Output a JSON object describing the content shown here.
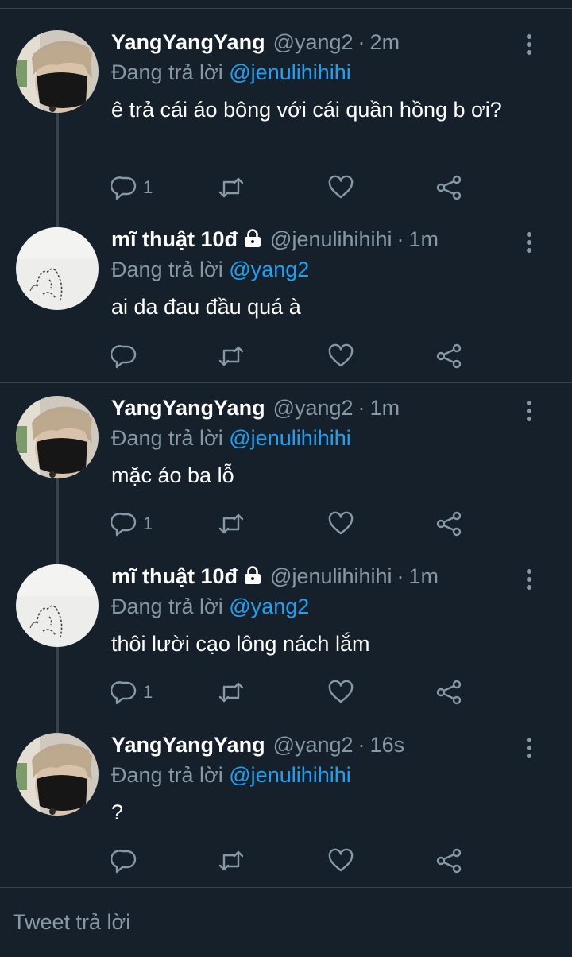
{
  "tweets": [
    {
      "name": "YangYangYang",
      "locked": false,
      "handle": "@yang2",
      "time": "2m",
      "replying_prefix": "Đang trả lời ",
      "replying_to": "@jenulihihihi",
      "text": "ê trả cái áo bông với cái quần hồng b ơi?",
      "reply_count": "1",
      "avatar": "masked-person"
    },
    {
      "name": "mĩ thuật 10đ",
      "locked": true,
      "handle": "@jenulihihihi",
      "time": "1m",
      "replying_prefix": "Đang trả lời ",
      "replying_to": "@yang2",
      "text": "ai da đau đầu quá à",
      "reply_count": "",
      "avatar": "sketch"
    },
    {
      "name": "YangYangYang",
      "locked": false,
      "handle": "@yang2",
      "time": "1m",
      "replying_prefix": "Đang trả lời ",
      "replying_to": "@jenulihihihi",
      "text": "mặc áo ba lỗ",
      "reply_count": "1",
      "avatar": "masked-person"
    },
    {
      "name": "mĩ thuật 10đ",
      "locked": true,
      "handle": "@jenulihihihi",
      "time": "1m",
      "replying_prefix": "Đang trả lời ",
      "replying_to": "@yang2",
      "text": "thôi lười cạo lông nách lắm",
      "reply_count": "1",
      "avatar": "sketch"
    },
    {
      "name": "YangYangYang",
      "locked": false,
      "handle": "@yang2",
      "time": "16s",
      "replying_prefix": "Đang trả lời ",
      "replying_to": "@jenulihihihi",
      "text": "?",
      "reply_count": "",
      "avatar": "masked-person"
    }
  ],
  "reply_box": {
    "placeholder": "Tweet trả lời"
  },
  "icons": {
    "reply": "reply-icon",
    "retweet": "retweet-icon",
    "like": "heart-icon",
    "share": "share-icon",
    "more": "more-options-icon",
    "lock": "lock-icon"
  },
  "colors": {
    "background": "#15202b",
    "text": "#ffffff",
    "secondary": "#8899a6",
    "mention": "#1da1f2",
    "divider": "#38444d"
  }
}
